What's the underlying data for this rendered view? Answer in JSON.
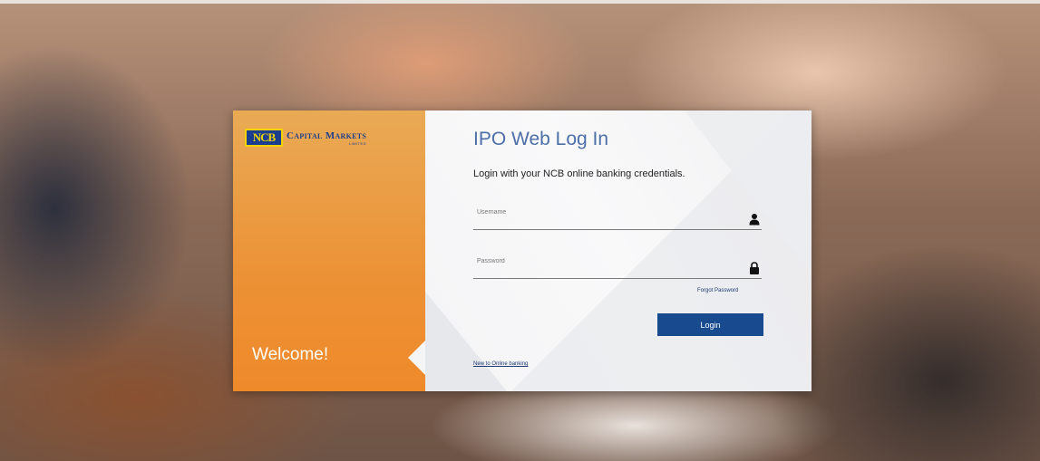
{
  "brand": {
    "logo_mark": "NCB",
    "name": "Capital Markets",
    "sub": "LIMITED",
    "welcome": "Welcome!"
  },
  "login": {
    "title": "IPO Web Log In",
    "subtitle": "Login with your NCB online banking credentials.",
    "username_placeholder": "Username",
    "password_placeholder": "Password",
    "forgot_password": "Forgot Password",
    "login_button": "Login",
    "new_user_link": "New to Online banking"
  },
  "icons": {
    "username": "user-icon",
    "password": "lock-icon"
  },
  "colors": {
    "brand_orange": "#ec9135",
    "brand_blue": "#1b3e8f",
    "title_blue": "#4d6fa8",
    "button_blue": "#174a8f"
  }
}
